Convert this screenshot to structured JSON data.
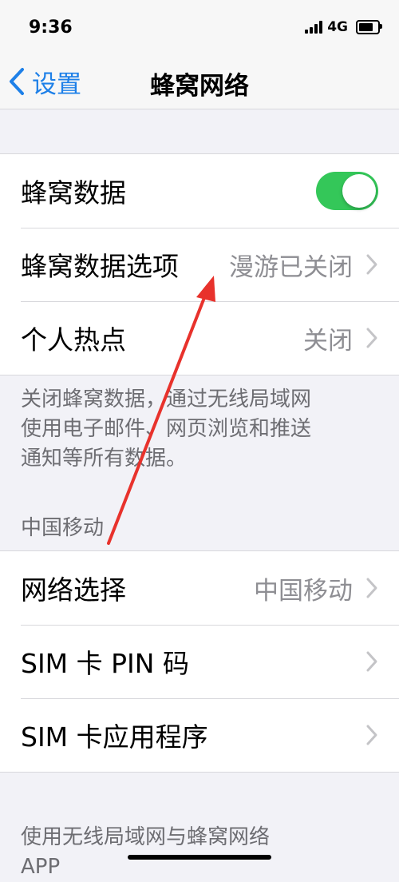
{
  "status_bar": {
    "time": "9:36",
    "network_type": "4G",
    "signal_bars": 4,
    "battery_level": 0.75
  },
  "nav_bar": {
    "back_label": "设置",
    "title": "蜂窝网络"
  },
  "group_cellular": {
    "cellular_data": {
      "label": "蜂窝数据",
      "enabled": true
    },
    "data_options": {
      "label": "蜂窝数据选项",
      "value": "漫游已关闭"
    },
    "hotspot": {
      "label": "个人热点",
      "value": "关闭"
    }
  },
  "footnote_cellular": {
    "line1": "关闭蜂窝数据，通过无线局域网",
    "line2": "使用电子邮件、网页浏览和推送",
    "line3": "通知等所有数据。"
  },
  "carrier_section": {
    "header": "中国移动",
    "network_selection": {
      "label": "网络选择",
      "value": "中国移动"
    },
    "sim_pin": {
      "label": "SIM 卡 PIN 码"
    },
    "sim_apps": {
      "label": "SIM 卡应用程序"
    }
  },
  "bottom_note": {
    "line1": "使用无线局域网与蜂窝网络",
    "line2": "APP"
  },
  "colors": {
    "accent": "#1e80e8",
    "toggle_on": "#34c759",
    "annotation_arrow": "#e8322c"
  }
}
